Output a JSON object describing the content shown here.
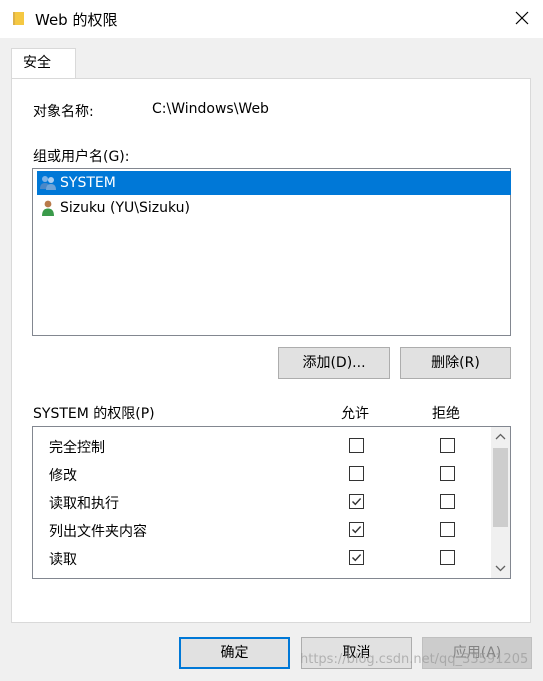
{
  "window": {
    "title": "Web 的权限",
    "close_icon": "close-icon",
    "folder_icon": "folder-icon"
  },
  "tabs": [
    {
      "label": "安全",
      "selected": true
    }
  ],
  "object": {
    "label": "对象名称:",
    "value": "C:\\Windows\\Web"
  },
  "groups": {
    "label": "组或用户名(G):",
    "items": [
      {
        "name": "SYSTEM",
        "icon": "user-group-icon",
        "selected": true
      },
      {
        "name": "Sizuku (YU\\Sizuku)",
        "icon": "user-icon",
        "selected": false
      }
    ]
  },
  "actions": {
    "add_label": "添加(D)...",
    "remove_label": "删除(R)"
  },
  "permissions": {
    "label": "SYSTEM 的权限(P)",
    "allow_header": "允许",
    "deny_header": "拒绝",
    "rows": [
      {
        "name": "完全控制",
        "allow": false,
        "deny": false
      },
      {
        "name": "修改",
        "allow": false,
        "deny": false
      },
      {
        "name": "读取和执行",
        "allow": true,
        "deny": false
      },
      {
        "name": "列出文件夹内容",
        "allow": true,
        "deny": false
      },
      {
        "name": "读取",
        "allow": true,
        "deny": false
      }
    ]
  },
  "footer": {
    "ok_label": "确定",
    "cancel_label": "取消",
    "apply_label": "应用(A)",
    "apply_enabled": false
  },
  "watermark": "https://blog.csdn.net/qq_33591205",
  "colors": {
    "selection": "#0078d7",
    "background": "#f0f0f0",
    "panel": "#ffffff"
  }
}
